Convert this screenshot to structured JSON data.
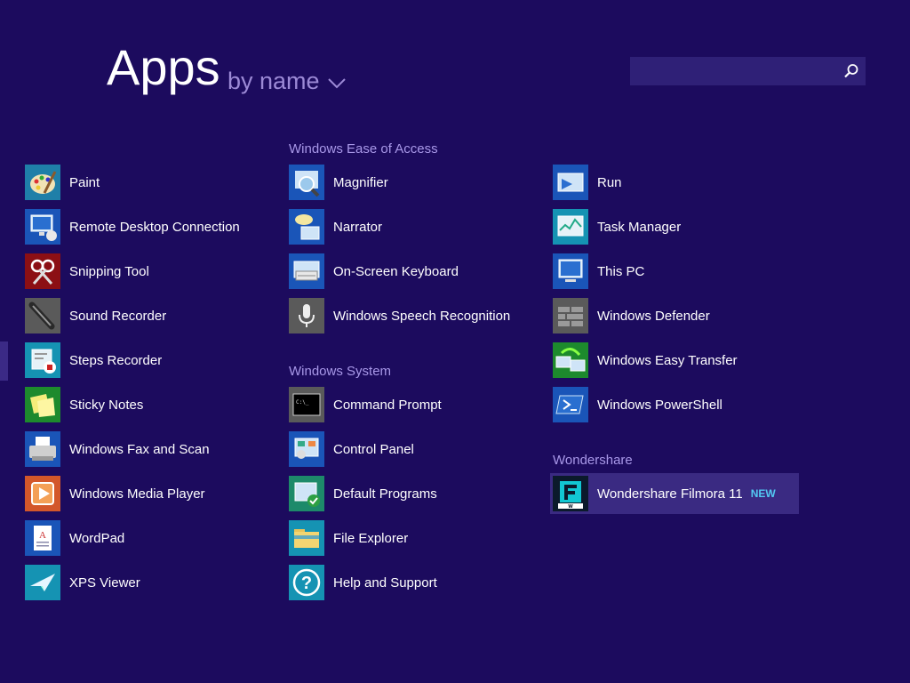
{
  "header": {
    "title": "Apps",
    "sort_label": "by name",
    "search_placeholder": ""
  },
  "groups": {
    "ease_of_access": "Windows Ease of Access",
    "system": "Windows System",
    "wondershare": "Wondershare"
  },
  "apps": {
    "paint": "Paint",
    "remote_desktop": "Remote Desktop Connection",
    "snipping_tool": "Snipping Tool",
    "sound_recorder": "Sound Recorder",
    "steps_recorder": "Steps Recorder",
    "sticky_notes": "Sticky Notes",
    "fax_scan": "Windows Fax and Scan",
    "media_player": "Windows Media Player",
    "wordpad": "WordPad",
    "xps_viewer": "XPS Viewer",
    "magnifier": "Magnifier",
    "narrator": "Narrator",
    "osk": "On-Screen Keyboard",
    "speech": "Windows Speech Recognition",
    "cmd": "Command Prompt",
    "control_panel": "Control Panel",
    "default_programs": "Default Programs",
    "file_explorer": "File Explorer",
    "help_support": "Help and Support",
    "run": "Run",
    "task_manager": "Task Manager",
    "this_pc": "This PC",
    "defender": "Windows Defender",
    "easy_transfer": "Windows Easy Transfer",
    "powershell": "Windows PowerShell",
    "filmora": "Wondershare Filmora 11",
    "filmora_badge": "NEW"
  },
  "colors": {
    "background": "#1c0b5e",
    "accent_text": "#a898e8",
    "badge": "#53c8f2",
    "highlight": "#3a2a82"
  }
}
